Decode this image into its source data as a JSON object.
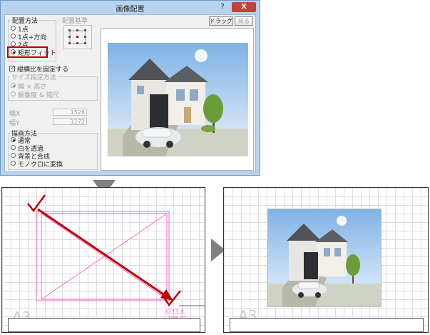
{
  "dialog": {
    "title": "画像配置",
    "help_label": "?",
    "close_label": "X",
    "placement": {
      "label": "配置方法",
      "options": [
        "1点",
        "1点+方向",
        "2点",
        "矩形フィット"
      ],
      "selected": "矩形フィット"
    },
    "base_label": "配置基準",
    "drag_button": "ドラッグ",
    "back_button": "戻る",
    "keep_ratio_label": "縦横比を固定する",
    "size_spec": {
      "label": "サイズ指定方法",
      "options": [
        "幅 × 高さ",
        "解像度 & 縮尺"
      ]
    },
    "width_label": "幅X",
    "width_value": "1528",
    "height_label": "幅Y",
    "height_value": "1272",
    "draw_method": {
      "label": "描画方法",
      "options": [
        "通常",
        "白を透過",
        "背景と合成",
        "モノクロに変換"
      ],
      "selected": "通常"
    }
  },
  "sheet_left": {
    "paper_size": "A3",
    "coord_readout": "(273.8, -196.0)"
  },
  "sheet_right": {
    "paper_size": "A3"
  },
  "colors": {
    "accent_red": "#c00000",
    "magenta": "#ff66cc",
    "dialog_frame": "#b8d3ee"
  }
}
